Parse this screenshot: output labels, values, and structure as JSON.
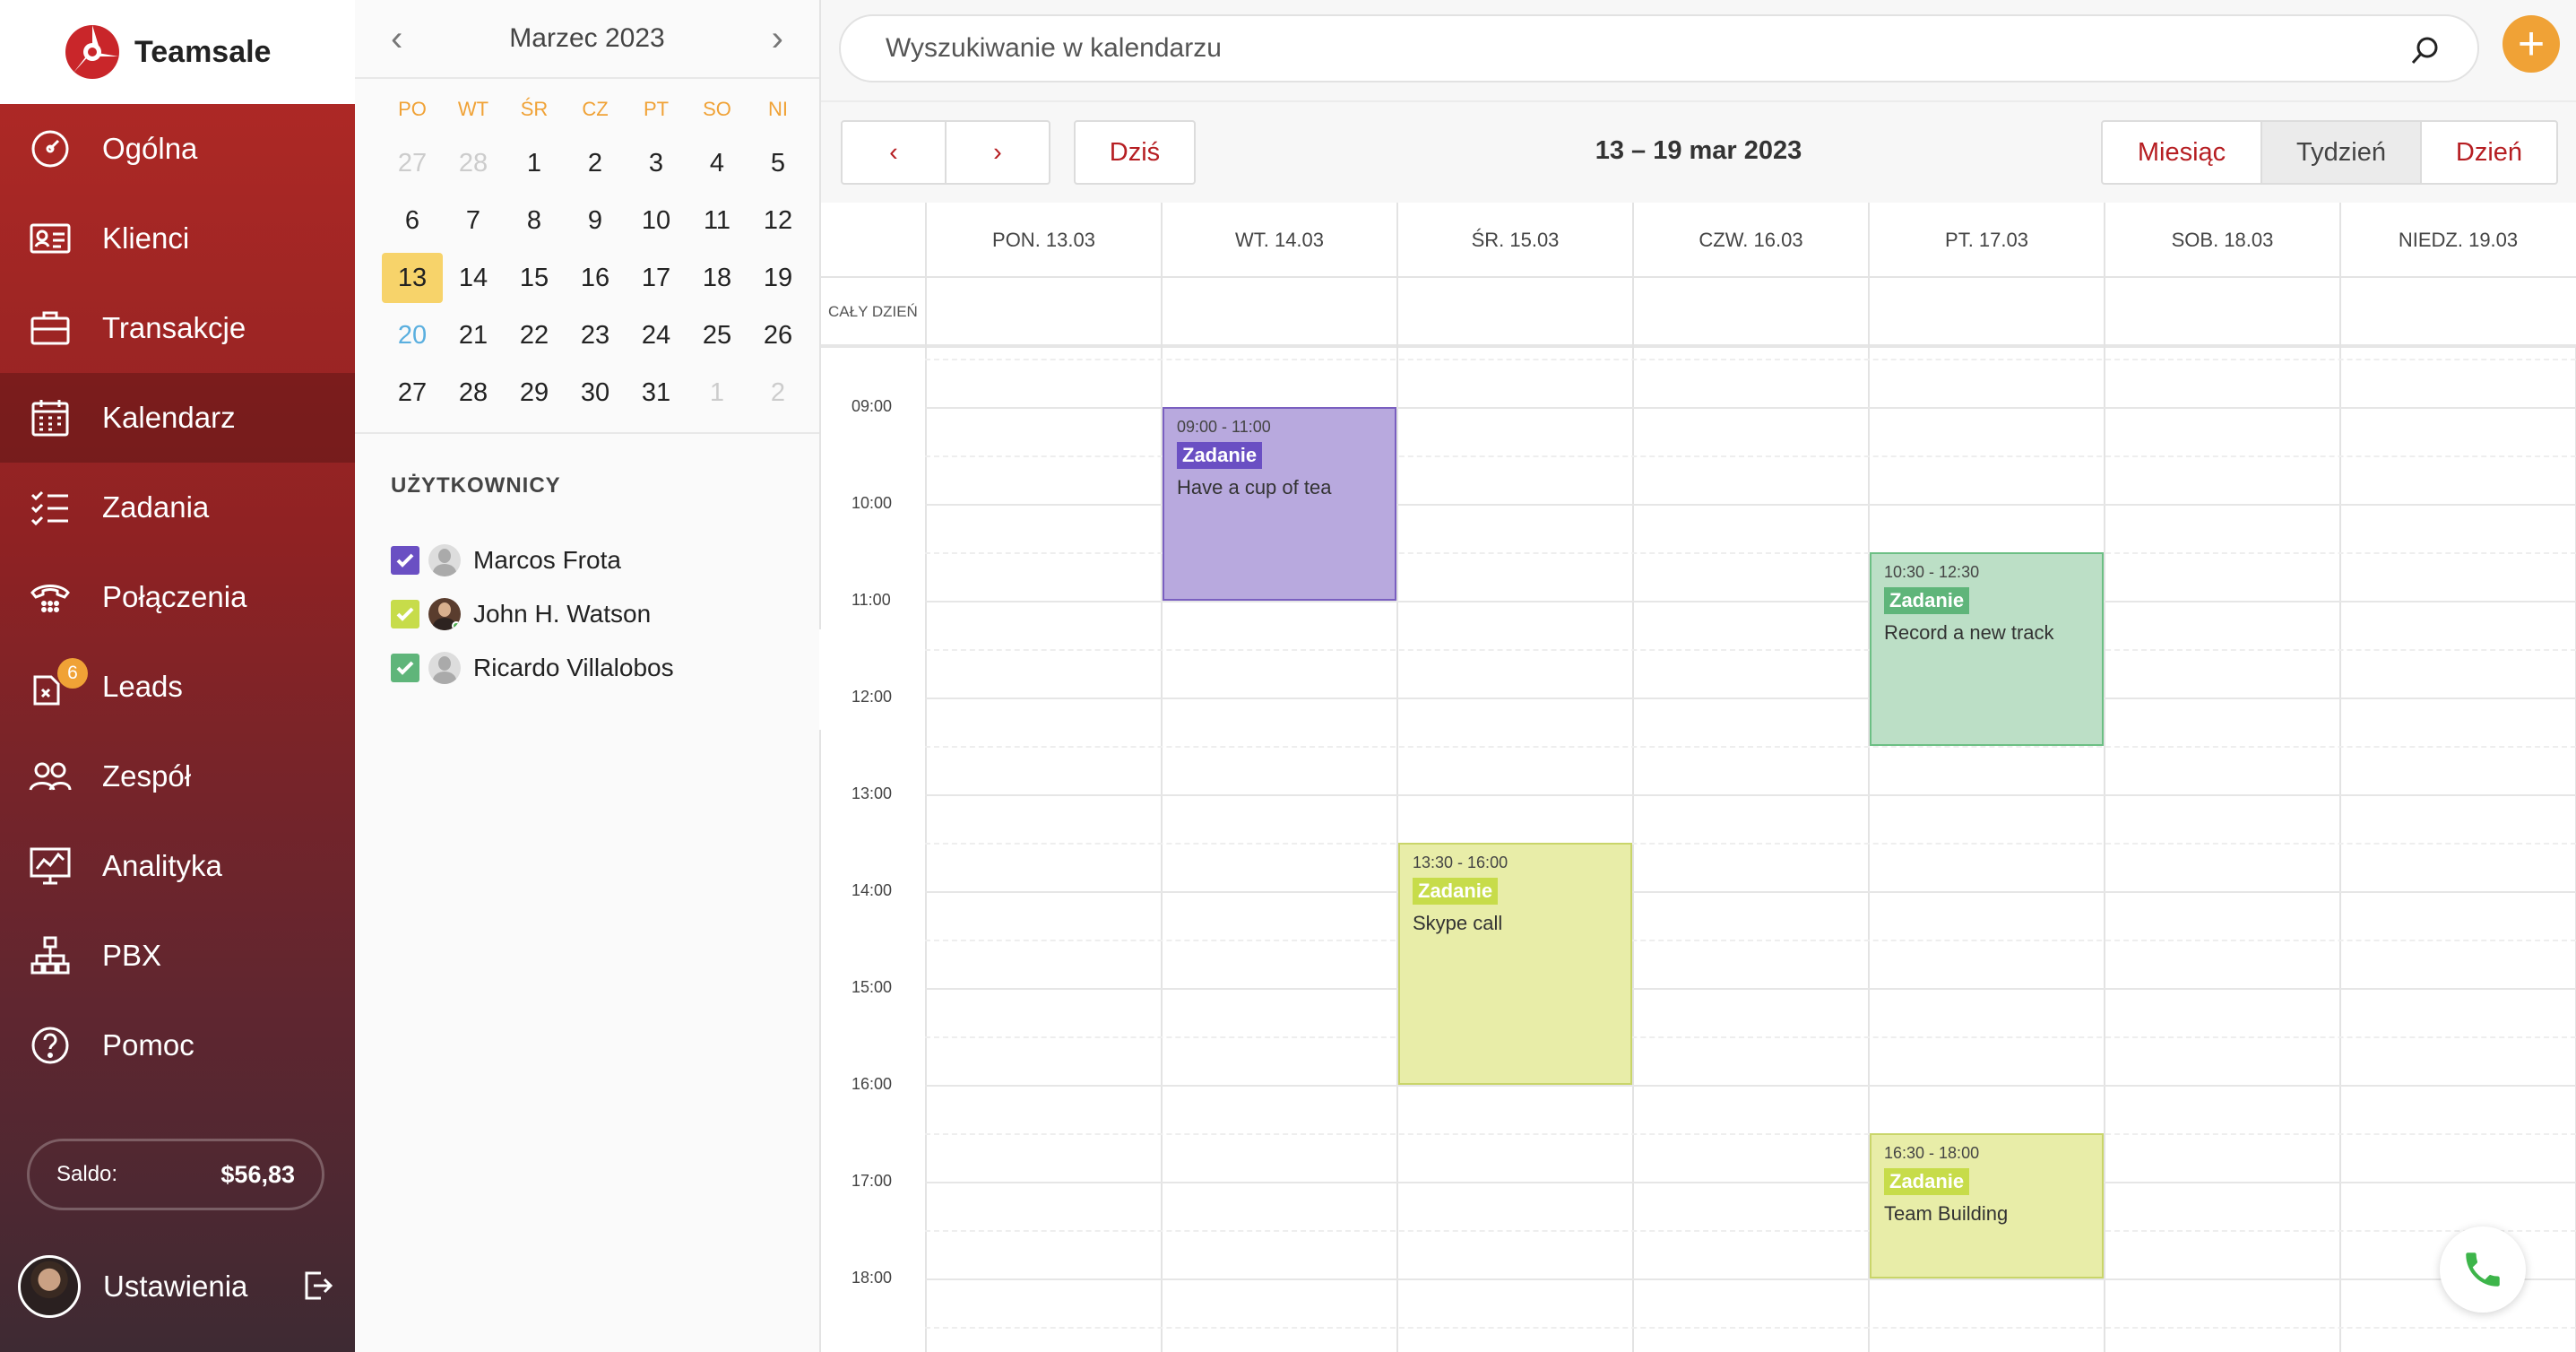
{
  "app": {
    "brand": "Teamsale"
  },
  "sidebar": {
    "items": [
      {
        "label": "Ogólna",
        "icon": "dashboard-icon"
      },
      {
        "label": "Klienci",
        "icon": "contact-card-icon"
      },
      {
        "label": "Transakcje",
        "icon": "briefcase-icon"
      },
      {
        "label": "Kalendarz",
        "icon": "calendar-icon"
      },
      {
        "label": "Zadania",
        "icon": "checklist-icon"
      },
      {
        "label": "Połączenia",
        "icon": "phone-icon"
      },
      {
        "label": "Leads",
        "icon": "leads-icon",
        "badge": "6"
      },
      {
        "label": "Zespół",
        "icon": "team-icon"
      },
      {
        "label": "Analityka",
        "icon": "analytics-icon"
      },
      {
        "label": "PBX",
        "icon": "pbx-icon"
      },
      {
        "label": "Pomoc",
        "icon": "help-icon"
      }
    ],
    "active": "Kalendarz",
    "balance": {
      "label": "Saldo:",
      "value": "$56,83"
    },
    "settings_label": "Ustawienia"
  },
  "mini_calendar": {
    "title": "Marzec 2023",
    "weekdays": [
      "PO",
      "WT",
      "ŚR",
      "CZ",
      "PT",
      "SO",
      "NI"
    ],
    "weeks": [
      [
        "27",
        "28",
        "1",
        "2",
        "3",
        "4",
        "5"
      ],
      [
        "6",
        "7",
        "8",
        "9",
        "10",
        "11",
        "12"
      ],
      [
        "13",
        "14",
        "15",
        "16",
        "17",
        "18",
        "19"
      ],
      [
        "20",
        "21",
        "22",
        "23",
        "24",
        "25",
        "26"
      ],
      [
        "27",
        "28",
        "29",
        "30",
        "31",
        "1",
        "2"
      ]
    ],
    "today": "13"
  },
  "users": {
    "title": "UŻYTKOWNICY",
    "list": [
      {
        "name": "Marcos Frota",
        "color": "#6a4fc3"
      },
      {
        "name": "John H. Watson",
        "color": "#c7dc4a"
      },
      {
        "name": "Ricardo Villalobos",
        "color": "#5fb57a"
      }
    ]
  },
  "search": {
    "placeholder": "Wyszukiwanie w kalendarzu"
  },
  "toolbar": {
    "today": "Dziś",
    "range": "13 – 19 mar 2023",
    "views": [
      "Miesiąc",
      "Tydzień",
      "Dzień"
    ],
    "active_view": "Tydzień"
  },
  "calendar": {
    "allday_label": "CAŁY DZIEŃ",
    "days": [
      "PON. 13.03",
      "WT. 14.03",
      "ŚR. 15.03",
      "CZW. 16.03",
      "PT. 17.03",
      "SOB. 18.03",
      "NIEDZ. 19.03"
    ],
    "hours": [
      "09:00",
      "10:00",
      "11:00",
      "12:00",
      "13:00",
      "14:00",
      "15:00",
      "16:00",
      "17:00",
      "18:00"
    ],
    "events": [
      {
        "day": 1,
        "start": "09:00",
        "end": "11:00",
        "time": "09:00 - 11:00",
        "tag": "Zadanie",
        "title": "Have a cup of tea",
        "bg": "#b8a9de",
        "border": "#7a5fc0",
        "tagbg": "#6a4fc3"
      },
      {
        "day": 4,
        "start": "10:30",
        "end": "12:30",
        "time": "10:30 - 12:30",
        "tag": "Zadanie",
        "title": "Record a new track",
        "bg": "#bcdfc6",
        "border": "#6cbf84",
        "tagbg": "#5fb57a"
      },
      {
        "day": 2,
        "start": "13:30",
        "end": "16:00",
        "time": "13:30 - 16:00",
        "tag": "Zadanie",
        "title": "Skype call",
        "bg": "#e8eda8",
        "border": "#c9d56a",
        "tagbg": "#c7dc4a"
      },
      {
        "day": 4,
        "start": "16:30",
        "end": "18:00",
        "time": "16:30 - 18:00",
        "tag": "Zadanie",
        "title": "Team Building",
        "bg": "#e8eda8",
        "border": "#c9d56a",
        "tagbg": "#c7dc4a"
      }
    ]
  }
}
